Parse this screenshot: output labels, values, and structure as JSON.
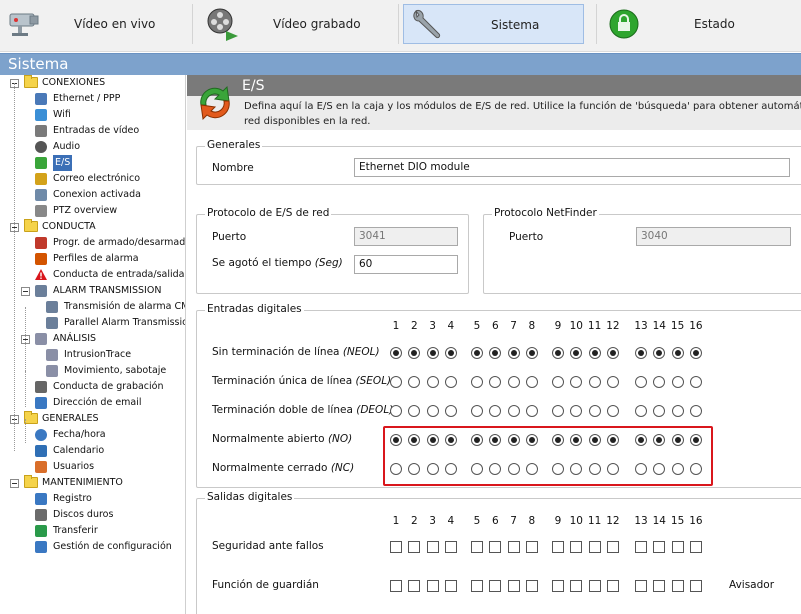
{
  "nav": {
    "tabs": [
      {
        "label": "Vídeo en vivo",
        "icon": "camera-icon",
        "active": false
      },
      {
        "label": "Vídeo grabado",
        "icon": "film-reel-icon",
        "active": false
      },
      {
        "label": "Sistema",
        "icon": "wrench-icon",
        "active": true
      },
      {
        "label": "Estado",
        "icon": "lock-status-icon",
        "active": false
      }
    ]
  },
  "page_title": "Sistema",
  "sidebar": {
    "items": [
      {
        "label": "CONEXIONES",
        "type": "category",
        "icon": "folder-icon"
      },
      {
        "label": "Ethernet / PPP",
        "icon": "ethernet-icon"
      },
      {
        "label": "Wifi",
        "icon": "wifi-icon"
      },
      {
        "label": "Entradas de vídeo",
        "icon": "video-input-icon"
      },
      {
        "label": "Audio",
        "icon": "headphones-icon"
      },
      {
        "label": "E/S",
        "icon": "io-arrows-icon",
        "selected": true
      },
      {
        "label": "Correo electrónico",
        "icon": "email-icon"
      },
      {
        "label": "Conexion activada",
        "icon": "connection-icon"
      },
      {
        "label": "PTZ overview",
        "icon": "ptz-camera-icon"
      },
      {
        "label": "CONDUCTA",
        "type": "category",
        "icon": "folder-icon"
      },
      {
        "label": "Progr. de armado/desarmado",
        "icon": "schedule-icon"
      },
      {
        "label": "Perfiles de alarma",
        "icon": "alarm-profile-icon"
      },
      {
        "label": "Conducta de entrada/salida(*)",
        "icon": "warning-icon"
      },
      {
        "label": "ALARM TRANSMISSION",
        "type": "subcategory",
        "icon": "server-icon"
      },
      {
        "label": "Transmisión de alarma CMS",
        "icon": "server-icon",
        "indent": 2
      },
      {
        "label": "Parallel Alarm Transmission",
        "icon": "server-icon",
        "indent": 2
      },
      {
        "label": "ANÁLISIS",
        "type": "subcategory",
        "icon": "gears-icon"
      },
      {
        "label": "IntrusionTrace",
        "icon": "gears-icon",
        "indent": 2
      },
      {
        "label": "Movimiento, sabotaje",
        "icon": "gears-icon",
        "indent": 2
      },
      {
        "label": "Conducta de grabación",
        "icon": "film-reel-icon"
      },
      {
        "label": "Dirección de email",
        "icon": "email-book-icon"
      },
      {
        "label": "GENERALES",
        "type": "category",
        "icon": "folder-icon"
      },
      {
        "label": "Fecha/hora",
        "icon": "clock-icon"
      },
      {
        "label": "Calendario",
        "icon": "calendar-icon"
      },
      {
        "label": "Usuarios",
        "icon": "users-icon"
      },
      {
        "label": "MANTENIMIENTO",
        "type": "category",
        "icon": "folder-icon"
      },
      {
        "label": "Registro",
        "icon": "log-icon"
      },
      {
        "label": "Discos duros",
        "icon": "hard-disk-icon"
      },
      {
        "label": "Transferir",
        "icon": "transfer-icon"
      },
      {
        "label": "Gestión de configuración",
        "icon": "config-check-icon"
      }
    ]
  },
  "section": {
    "title": "E/S",
    "description_line1": "Defina aquí la E/S en la caja y los módulos de E/S de red. Utilice la función de 'búsqueda' para obtener automáticame",
    "description_line2": "red disponibles en la red."
  },
  "generales": {
    "legend": "Generales",
    "nombre_label": "Nombre",
    "nombre_value": "Ethernet DIO module"
  },
  "protocolo_red": {
    "legend": "Protocolo de E/S de red",
    "puerto_label": "Puerto",
    "puerto_value": "3041",
    "timeout_label": "Se agotó el tiempo",
    "timeout_unit": "(Seg)",
    "timeout_value": "60"
  },
  "protocolo_netfinder": {
    "legend": "Protocolo NetFinder",
    "puerto_label": "Puerto",
    "puerto_value": "3040"
  },
  "entradas": {
    "legend": "Entradas digitales",
    "numbers": [
      "1",
      "2",
      "3",
      "4",
      "5",
      "6",
      "7",
      "8",
      "9",
      "10",
      "11",
      "12",
      "13",
      "14",
      "15",
      "16"
    ],
    "rows": [
      {
        "label": "Sin terminación de línea",
        "abbr": "(NEOL)",
        "selected": true
      },
      {
        "label": "Terminación única de línea",
        "abbr": "(SEOL)",
        "selected": false
      },
      {
        "label": "Terminación doble de línea",
        "abbr": "(DEOL)",
        "selected": false
      },
      {
        "label": "Normalmente abierto",
        "abbr": "(NO)",
        "selected": true
      },
      {
        "label": "Normalmente cerrado",
        "abbr": "(NC)",
        "selected": false
      }
    ]
  },
  "salidas": {
    "legend": "Salidas digitales",
    "numbers": [
      "1",
      "2",
      "3",
      "4",
      "5",
      "6",
      "7",
      "8",
      "9",
      "10",
      "11",
      "12",
      "13",
      "14",
      "15",
      "16"
    ],
    "rows": [
      {
        "label": "Seguridad ante fallos",
        "extra": ""
      },
      {
        "label": "Función de guardián",
        "extra": "Avisador"
      }
    ]
  }
}
